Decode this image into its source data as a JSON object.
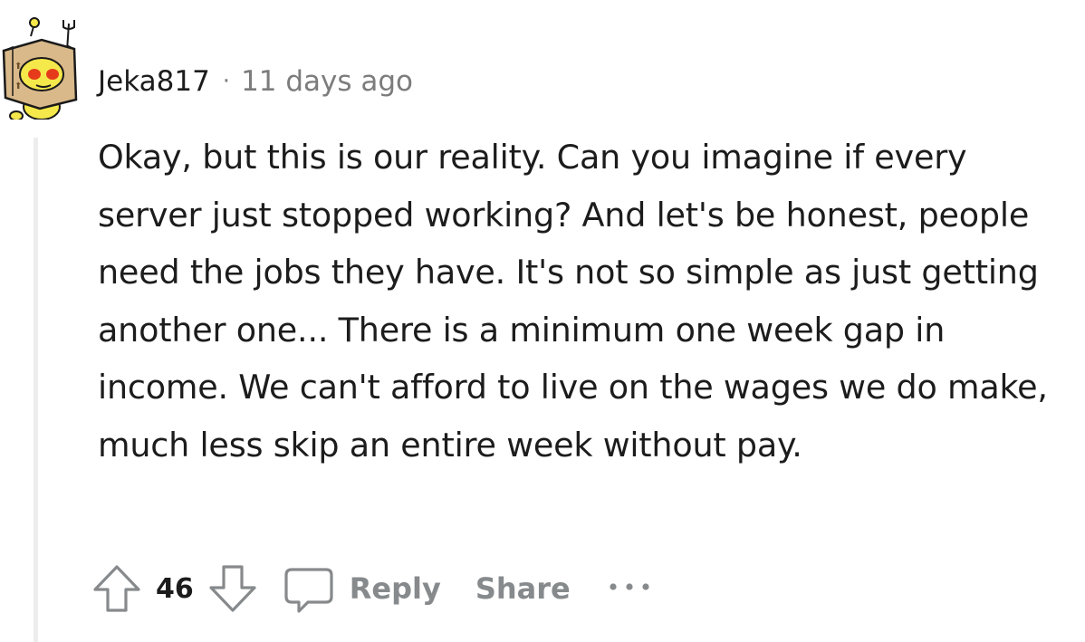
{
  "comment": {
    "username": "Jeka817",
    "separator": "·",
    "timestamp": "11 days ago",
    "body": "Okay, but this is our reality. Can you imagine if every server just stopped working? And let's be honest, people need the jobs they have. It's not so simple as just getting another one... There is a minimum one week gap in income. We can't afford to live on the wages we do make, much less skip an entire week without pay."
  },
  "actions": {
    "vote_count": "46",
    "reply_label": "Reply",
    "share_label": "Share"
  },
  "icons": {
    "upvote": "arrow-up-outline-icon",
    "downvote": "arrow-down-outline-icon",
    "reply": "speech-bubble-icon",
    "more": "horizontal-ellipsis-icon",
    "avatar": "snoo-box-head-avatar"
  },
  "colors": {
    "text": "#1c1c1c",
    "muted": "#7c7c7c",
    "action": "#878a8c",
    "thread_line": "#ededed",
    "avatar_yellow": "#f5e84a",
    "avatar_box": "#d9b98a",
    "avatar_eyes": "#e53b1b"
  }
}
